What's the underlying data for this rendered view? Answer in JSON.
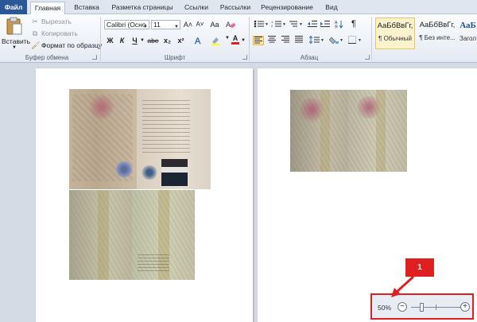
{
  "tabs": [
    {
      "label": "Файл"
    },
    {
      "label": "Главная"
    },
    {
      "label": "Вставка"
    },
    {
      "label": "Разметка страницы"
    },
    {
      "label": "Ссылки"
    },
    {
      "label": "Рассылки"
    },
    {
      "label": "Рецензирование"
    },
    {
      "label": "Вид"
    }
  ],
  "clipboard": {
    "paste_label": "Вставить",
    "cut_label": "Вырезать",
    "copy_label": "Копировать",
    "format_painter_label": "Формат по образцу",
    "group_label": "Буфер обмена"
  },
  "font": {
    "family_value": "Calibri (Осно",
    "size_value": "11",
    "bold": "Ж",
    "italic": "К",
    "underline": "Ч",
    "strike": "abe",
    "subscript": "x₂",
    "superscript": "x²",
    "grow": "A˄",
    "shrink": "A˅",
    "case": "Aa",
    "font_color": "A",
    "group_label": "Шрифт"
  },
  "paragraph": {
    "group_label": "Абзац",
    "pilcrow": "¶"
  },
  "styles": {
    "items": [
      {
        "sample": "АаБбВвГг,",
        "name": "¶ Обычный"
      },
      {
        "sample": "АаБбВвГг,",
        "name": "¶ Без инте..."
      },
      {
        "sample": "АаБ",
        "name": "Загол"
      }
    ]
  },
  "zoom": {
    "percent_label": "50%",
    "minus": "−",
    "plus": "+"
  },
  "callout": {
    "number": "1"
  },
  "colors": {
    "file_tab": "#2b5797",
    "highlight": "#e02020"
  }
}
